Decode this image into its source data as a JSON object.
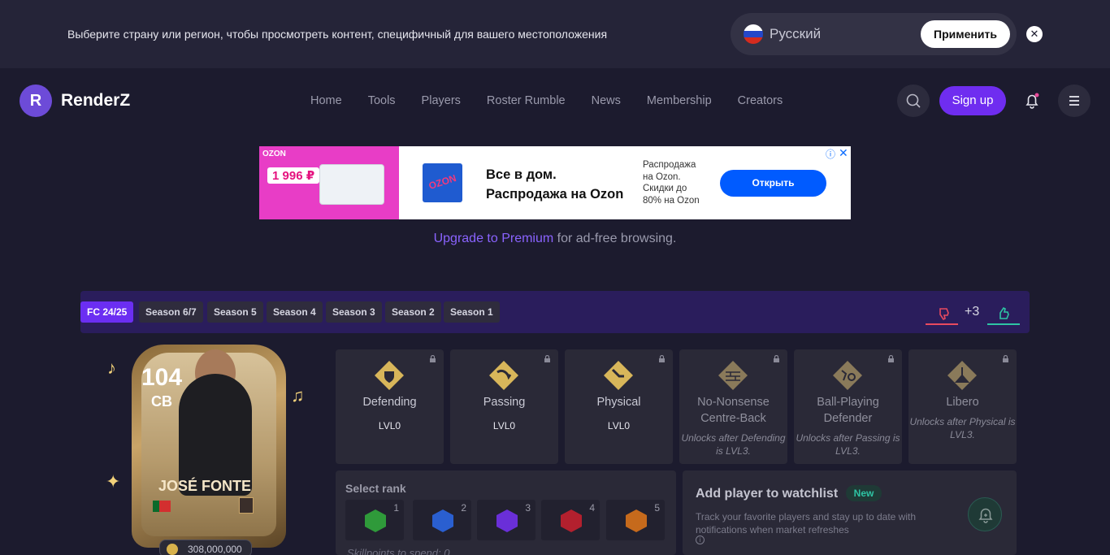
{
  "region_banner": {
    "message": "Выберите страну или регион, чтобы просмотреть контент, специфичный для вашего местоположения",
    "language": "Русский",
    "apply_label": "Применить",
    "close_symbol": "✕"
  },
  "brand": {
    "logo_letter": "R",
    "name": "RenderZ"
  },
  "nav": {
    "items": [
      "Home",
      "Tools",
      "Players",
      "Roster Rumble",
      "News",
      "Membership",
      "Creators"
    ],
    "signup_label": "Sign up"
  },
  "ad": {
    "brand_small": "OZON",
    "price": "1 996 ₽",
    "logo_text": "OZON",
    "headline_1": "Все в дом.",
    "headline_2": "Распродажа на Ozon",
    "subtext": "Распродажа на Ozon. Скидки до 80% на Ozon",
    "cta": "Открыть",
    "info": "ⓘ",
    "close": "✕"
  },
  "upgrade": {
    "link": "Upgrade to Premium",
    "rest": " for ad-free browsing."
  },
  "seasons": {
    "tabs": [
      "FC 24/25",
      "Season 6/7",
      "Season 5",
      "Season 4",
      "Season 3",
      "Season 2",
      "Season 1"
    ],
    "active_index": 0,
    "vote_count": "+3"
  },
  "card": {
    "rating": "104",
    "position": "CB",
    "name": "JOSÉ FONTE",
    "price": "308,000,000"
  },
  "skills": [
    {
      "title": "Defending",
      "level": "LVL0",
      "locked": false
    },
    {
      "title": "Passing",
      "level": "LVL0",
      "locked": false
    },
    {
      "title": "Physical",
      "level": "LVL0",
      "locked": false
    },
    {
      "title": "No-Nonsense Centre-Back",
      "note": "Unlocks after Defending is LVL3.",
      "locked": true
    },
    {
      "title": "Ball-Playing Defender",
      "note": "Unlocks after Passing is LVL3.",
      "locked": true
    },
    {
      "title": "Libero",
      "note": "Unlocks after Physical is LVL3.",
      "locked": true
    }
  ],
  "rank": {
    "title": "Select rank",
    "ranks": [
      {
        "num": "1",
        "color": "#2f9a3a"
      },
      {
        "num": "2",
        "color": "#2a5fd0"
      },
      {
        "num": "3",
        "color": "#6a2fd8"
      },
      {
        "num": "4",
        "color": "#b3202e"
      },
      {
        "num": "5",
        "color": "#c66a1c"
      }
    ],
    "skillpoints": "Skillpoints to spend: 0"
  },
  "watchlist": {
    "title": "Add player to watchlist",
    "badge": "New",
    "description": "Track your favorite players and stay up to date with notifications when market refreshes",
    "info": "i"
  },
  "colors": {
    "accent": "#6f2df0",
    "background": "#1c1b2e",
    "positive": "#2ec4a4",
    "negative": "#e84a5f"
  }
}
